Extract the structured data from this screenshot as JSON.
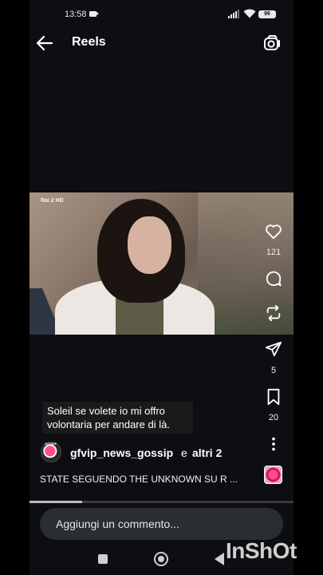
{
  "status_bar": {
    "time": "13:58",
    "battery": "96",
    "icons": [
      "video-record-icon",
      "signal-icon",
      "wifi-icon",
      "battery-icon"
    ]
  },
  "header": {
    "title": "Reels",
    "back_icon": "arrow-left-icon",
    "camera_icon": "camera-icon"
  },
  "video": {
    "channel_logo": "Rai 2 HD"
  },
  "actions": {
    "likes": "121",
    "shares": "5",
    "saves": "20",
    "icons": [
      "heart-icon",
      "comment-icon",
      "repost-icon",
      "send-icon",
      "bookmark-icon",
      "more-icon"
    ]
  },
  "caption": {
    "text": "Soleil se volete io mi offro volontaria per andare di là."
  },
  "author": {
    "username": "gfvip_news_gossip",
    "joiner": "e",
    "others": "altri 2"
  },
  "description": {
    "text": "STATE SEGUENDO THE UNKNOWN SU R ..."
  },
  "playback": {
    "progress": 0.2
  },
  "comment": {
    "placeholder": "Aggiungi un commento..."
  },
  "watermark": {
    "text": "InShOt"
  },
  "colors": {
    "background": "#0c0e11",
    "comment_box": "#2a2d31",
    "accent_pink": "#ff4d8d"
  }
}
